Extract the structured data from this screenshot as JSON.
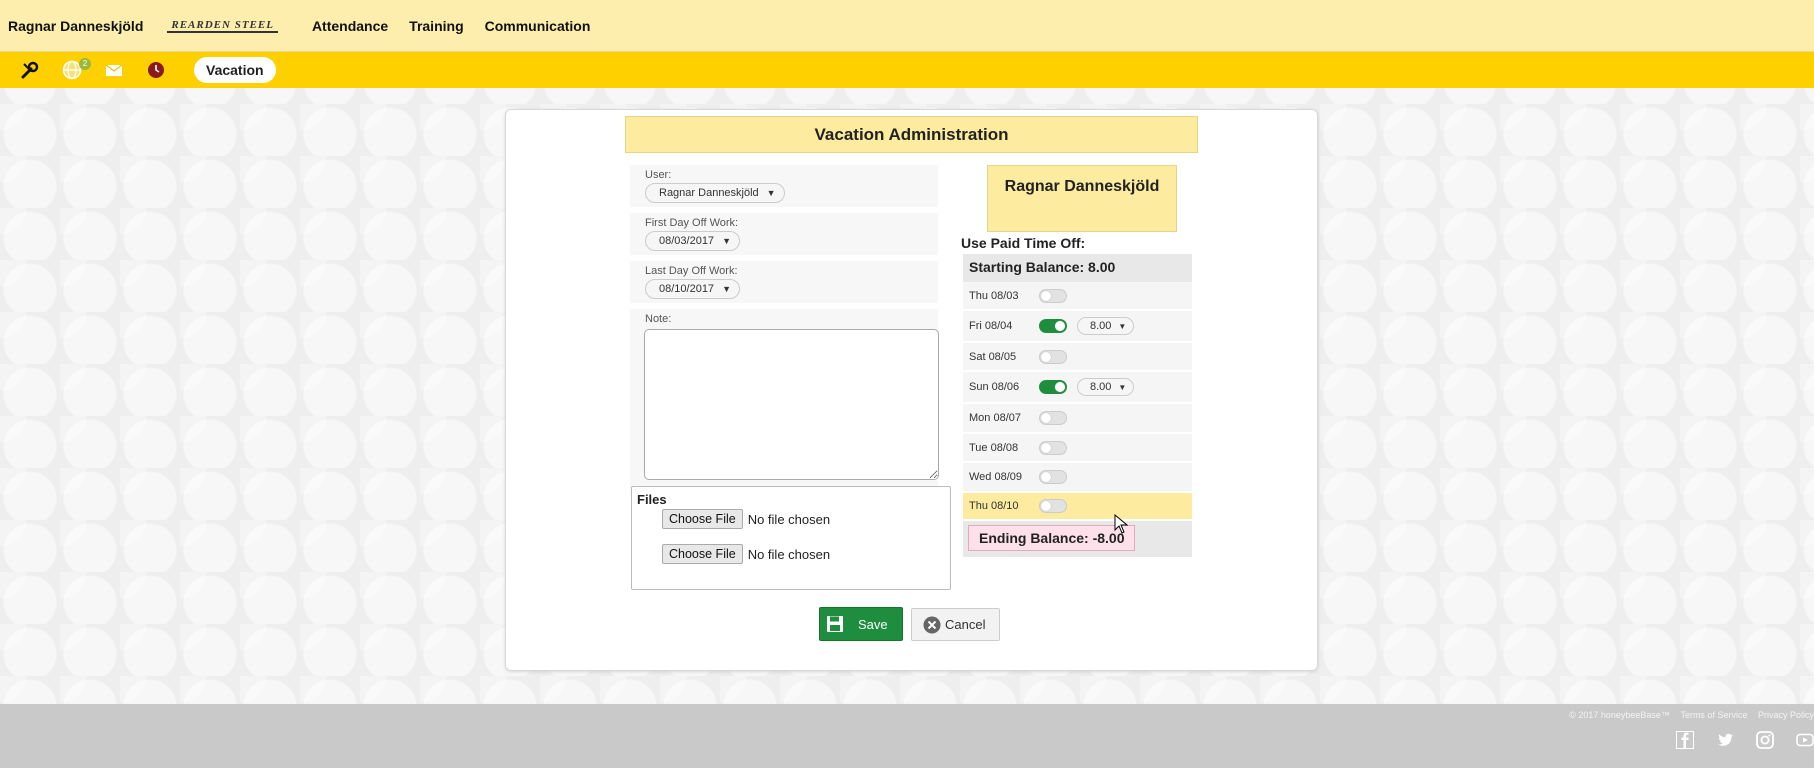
{
  "topbar": {
    "user_name": "Ragnar Danneskjöld",
    "brand": "REARDEN STEEL",
    "nav": [
      "Attendance",
      "Training",
      "Communication"
    ]
  },
  "subbar": {
    "icons": [
      "tools-icon",
      "globe-icon",
      "mail-icon",
      "clock-icon"
    ],
    "globe_badge": "2",
    "active_pill": "Vacation"
  },
  "form": {
    "title": "Vacation Administration",
    "user_label": "User:",
    "user_value": "Ragnar Danneskjöld",
    "first_day_label": "First Day Off Work:",
    "first_day_value": "08/03/2017",
    "last_day_label": "Last Day Off Work:",
    "last_day_value": "08/10/2017",
    "note_label": "Note:",
    "note_value": "",
    "files_label": "Files",
    "choose_file_label": "Choose File",
    "no_file_text": "No file chosen"
  },
  "pto": {
    "employee_name": "Ragnar Danneskjöld",
    "title": "Use Paid Time Off:",
    "starting_balance": "Starting Balance: 8.00",
    "days": [
      {
        "label": "Thu 08/03",
        "on": false,
        "hours": ""
      },
      {
        "label": "Fri 08/04",
        "on": true,
        "hours": "8.00"
      },
      {
        "label": "Sat 08/05",
        "on": false,
        "hours": ""
      },
      {
        "label": "Sun 08/06",
        "on": true,
        "hours": "8.00"
      },
      {
        "label": "Mon 08/07",
        "on": false,
        "hours": ""
      },
      {
        "label": "Tue 08/08",
        "on": false,
        "hours": ""
      },
      {
        "label": "Wed 08/09",
        "on": false,
        "hours": ""
      },
      {
        "label": "Thu 08/10",
        "on": false,
        "hours": ""
      }
    ],
    "ending_balance": "Ending Balance: -8.00"
  },
  "buttons": {
    "save": "Save",
    "cancel": "Cancel"
  },
  "footer": {
    "copyright": "© 2017 honeybeeBase™",
    "terms": "Terms of Service",
    "privacy": "Privacy Policy",
    "social": [
      "facebook-icon",
      "twitter-icon",
      "instagram-icon",
      "youtube-icon"
    ]
  },
  "colors": {
    "topbar": "#fdeeae",
    "subbar": "#fed000",
    "accent_green": "#1e8e3e",
    "panel_yellow": "#fdeba0",
    "ending_balance_bg": "#fde0ea"
  }
}
